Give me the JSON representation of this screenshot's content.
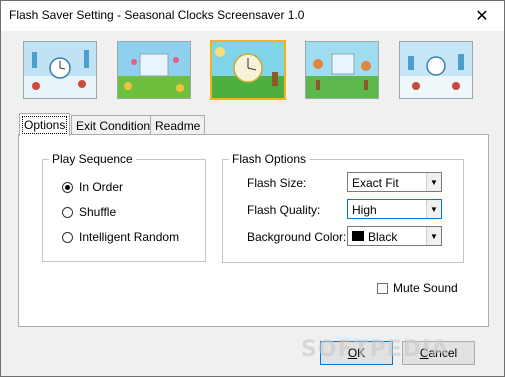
{
  "window": {
    "title": "Flash Saver Setting - Seasonal Clocks Screensaver 1.0",
    "close_symbol": "✕"
  },
  "thumbnails": [
    {
      "name": "winter-clocks",
      "sky": "#bfe3f5",
      "ground": "#e8f4f8",
      "accent": "#d14b3a",
      "selected": false
    },
    {
      "name": "spring-garden-clock",
      "sky": "#8fd0ee",
      "ground": "#6fbf3f",
      "accent": "#f1c23d",
      "selected": false
    },
    {
      "name": "summer-clock",
      "sky": "#7fd4e8",
      "ground": "#4caf3e",
      "accent": "#f6e07a",
      "selected": true
    },
    {
      "name": "autumn-clocks",
      "sky": "#9fdcf0",
      "ground": "#5cb84a",
      "accent": "#e0863c",
      "selected": false
    },
    {
      "name": "winter-village-clock",
      "sky": "#c7e6f5",
      "ground": "#eef6fa",
      "accent": "#c9473a",
      "selected": false
    }
  ],
  "tabs": [
    {
      "label": "Options",
      "active": true
    },
    {
      "label": "Exit Conditions",
      "active": false
    },
    {
      "label": "Readme",
      "active": false
    }
  ],
  "play_sequence": {
    "title": "Play Sequence",
    "options": [
      {
        "label": "In Order",
        "checked": true
      },
      {
        "label": "Shuffle",
        "checked": false
      },
      {
        "label": "Intelligent Random",
        "checked": false
      }
    ]
  },
  "flash_options": {
    "title": "Flash Options",
    "flash_size": {
      "label": "Flash Size:",
      "value": "Exact Fit"
    },
    "flash_quality": {
      "label": "Flash Quality:",
      "value": "High"
    },
    "background_color": {
      "label": "Background Color:",
      "value": "Black",
      "swatch": "#000000"
    }
  },
  "mute_sound": {
    "label": "Mute Sound",
    "checked": false
  },
  "buttons": {
    "ok": "OK",
    "cancel": "Cancel"
  },
  "watermark": "SOFTPEDIA"
}
